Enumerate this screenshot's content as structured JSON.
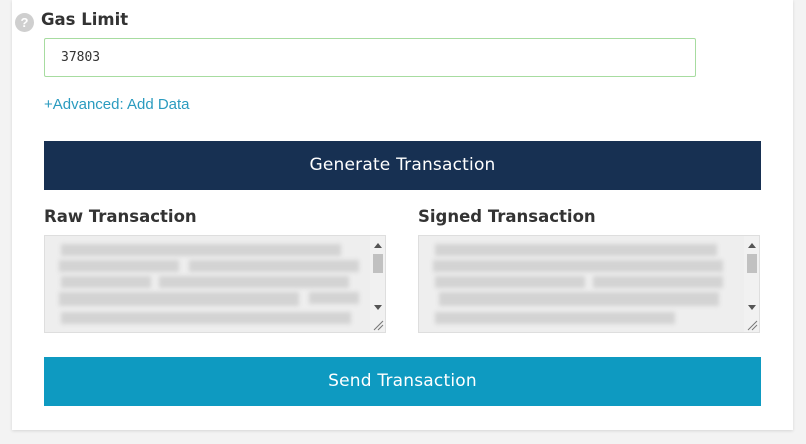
{
  "gas_limit": {
    "label": "Gas Limit",
    "value": "37803",
    "help_icon_glyph": "?"
  },
  "advanced_link": "+Advanced: Add Data",
  "generate_button": "Generate Transaction",
  "raw_transaction": {
    "label": "Raw Transaction"
  },
  "signed_transaction": {
    "label": "Signed Transaction"
  },
  "send_button": "Send Transaction",
  "colors": {
    "generate_button_bg": "#173052",
    "send_button_bg": "#0e9ac1",
    "link": "#2a9bbf",
    "input_border": "#a7dca0"
  }
}
